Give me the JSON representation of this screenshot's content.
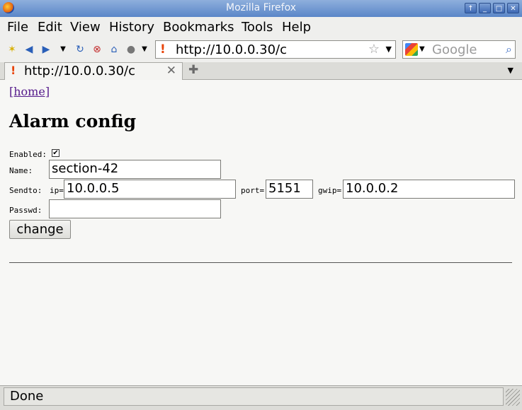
{
  "window": {
    "title": "Mozilla Firefox",
    "buttons": [
      "↑",
      "_",
      "□",
      "✕"
    ]
  },
  "menu": [
    "File",
    "Edit",
    "View",
    "History",
    "Bookmarks",
    "Tools",
    "Help"
  ],
  "url": {
    "value": "http://10.0.0.30/c"
  },
  "search": {
    "placeholder": "Google"
  },
  "tab": {
    "title": "http://10.0.0.30/c"
  },
  "page": {
    "home_link": "[home]",
    "heading": "Alarm config",
    "enabled_label": "Enabled:",
    "enabled_checked": true,
    "name_label": "Name:",
    "name_value": "section-42",
    "sendto_label": "Sendto:",
    "ip_label": "ip=",
    "ip_value": "10.0.0.5",
    "port_label": "port=",
    "port_value": "5151",
    "gwip_label": "gwip=",
    "gwip_value": "10.0.0.2",
    "passwd_label": "Passwd:",
    "passwd_value": "",
    "change_button": "change"
  },
  "status": {
    "text": "Done"
  }
}
